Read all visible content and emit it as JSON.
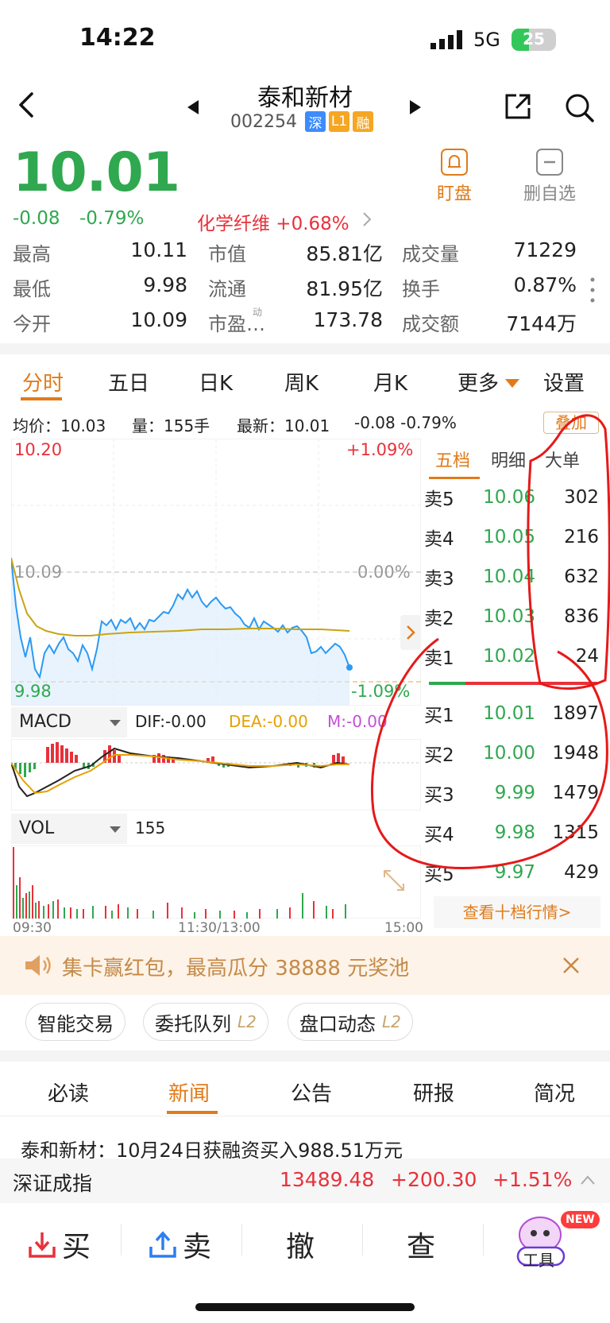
{
  "status_bar": {
    "time": "14:22",
    "network": "5G",
    "battery": "25"
  },
  "header": {
    "title": "泰和新材",
    "code": "002254",
    "tags": [
      {
        "text": "深",
        "color": "#3d8bfd"
      },
      {
        "text": "L1",
        "color": "#f5a623"
      },
      {
        "text": "融",
        "color": "#f5a623"
      }
    ],
    "watch_label": "盯盘",
    "remove_label": "删自选"
  },
  "quote": {
    "price": "10.01",
    "change": "-0.08",
    "change_pct": "-0.79%",
    "sector": "化学纤维 +0.68%",
    "stats": [
      {
        "label": "最高",
        "value": "10.11",
        "color": "#e8313a"
      },
      {
        "label": "市值",
        "value": "85.81亿",
        "color": "#222222"
      },
      {
        "label": "成交量",
        "value": "71229",
        "color": "#222222"
      },
      {
        "label": "最低",
        "value": "9.98",
        "color": "#2fa84f"
      },
      {
        "label": "流通",
        "value": "81.95亿",
        "color": "#222222"
      },
      {
        "label": "换手",
        "value": "0.87%",
        "color": "#222222"
      },
      {
        "label": "今开",
        "value": "10.09",
        "color": "#999999"
      },
      {
        "label": "市盈…",
        "value": "173.78",
        "color": "#222222"
      },
      {
        "label": "成交额",
        "value": "7144万",
        "color": "#222222"
      }
    ],
    "pe_sup": "动"
  },
  "chart_tabs": [
    "分时",
    "五日",
    "日K",
    "周K",
    "月K",
    "更多",
    "设置"
  ],
  "chart_info": {
    "avg": "均价：10.03",
    "vol": "量：155手",
    "latest": "最新：10.01",
    "change": "-0.08 -0.79%",
    "overlay": "叠加"
  },
  "chart_axes": {
    "top_price": "10.20",
    "top_pct": "+1.09%",
    "mid_price": "10.09",
    "mid_pct": "0.00%",
    "bot_price": "9.98",
    "bot_pct": "-1.09%"
  },
  "indicators": {
    "macd_label": "MACD",
    "dif": "DIF:-0.00",
    "dea": "DEA:-0.00",
    "m": "M:-0.00",
    "vol_label": "VOL",
    "vol_value": "155",
    "time_start": "09:30",
    "time_mid": "11:30/13:00",
    "time_end": "15:00"
  },
  "orderbook": {
    "tabs": [
      "五档",
      "明细",
      "大单"
    ],
    "asks": [
      {
        "label": "卖5",
        "price": "10.06",
        "vol": "302"
      },
      {
        "label": "卖4",
        "price": "10.05",
        "vol": "216"
      },
      {
        "label": "卖3",
        "price": "10.04",
        "vol": "632"
      },
      {
        "label": "卖2",
        "price": "10.03",
        "vol": "836"
      },
      {
        "label": "卖1",
        "price": "10.02",
        "vol": "24"
      }
    ],
    "bids": [
      {
        "label": "买1",
        "price": "10.01",
        "vol": "1897"
      },
      {
        "label": "买2",
        "price": "10.00",
        "vol": "1948"
      },
      {
        "label": "买3",
        "price": "9.99",
        "vol": "1479"
      },
      {
        "label": "买4",
        "price": "9.98",
        "vol": "1315"
      },
      {
        "label": "买5",
        "price": "9.97",
        "vol": "429"
      }
    ],
    "more": "查看十档行情>"
  },
  "banner": {
    "text": "集卡赢红包，最高瓜分 38888 元奖池"
  },
  "pills": [
    {
      "text": "智能交易",
      "l2": ""
    },
    {
      "text": "委托队列",
      "l2": "L2"
    },
    {
      "text": "盘口动态",
      "l2": "L2"
    }
  ],
  "news_tabs": [
    "必读",
    "新闻",
    "公告",
    "研报",
    "简况"
  ],
  "news_headline": "泰和新材：10月24日获融资买入988.51万元",
  "index_bar": {
    "name": "深证成指",
    "value": "13489.48",
    "change": "+200.30",
    "pct": "+1.51%"
  },
  "actions": {
    "buy": "买",
    "sell": "卖",
    "cancel": "撤",
    "query": "查",
    "tools": "工具",
    "new_badge": "NEW"
  }
}
